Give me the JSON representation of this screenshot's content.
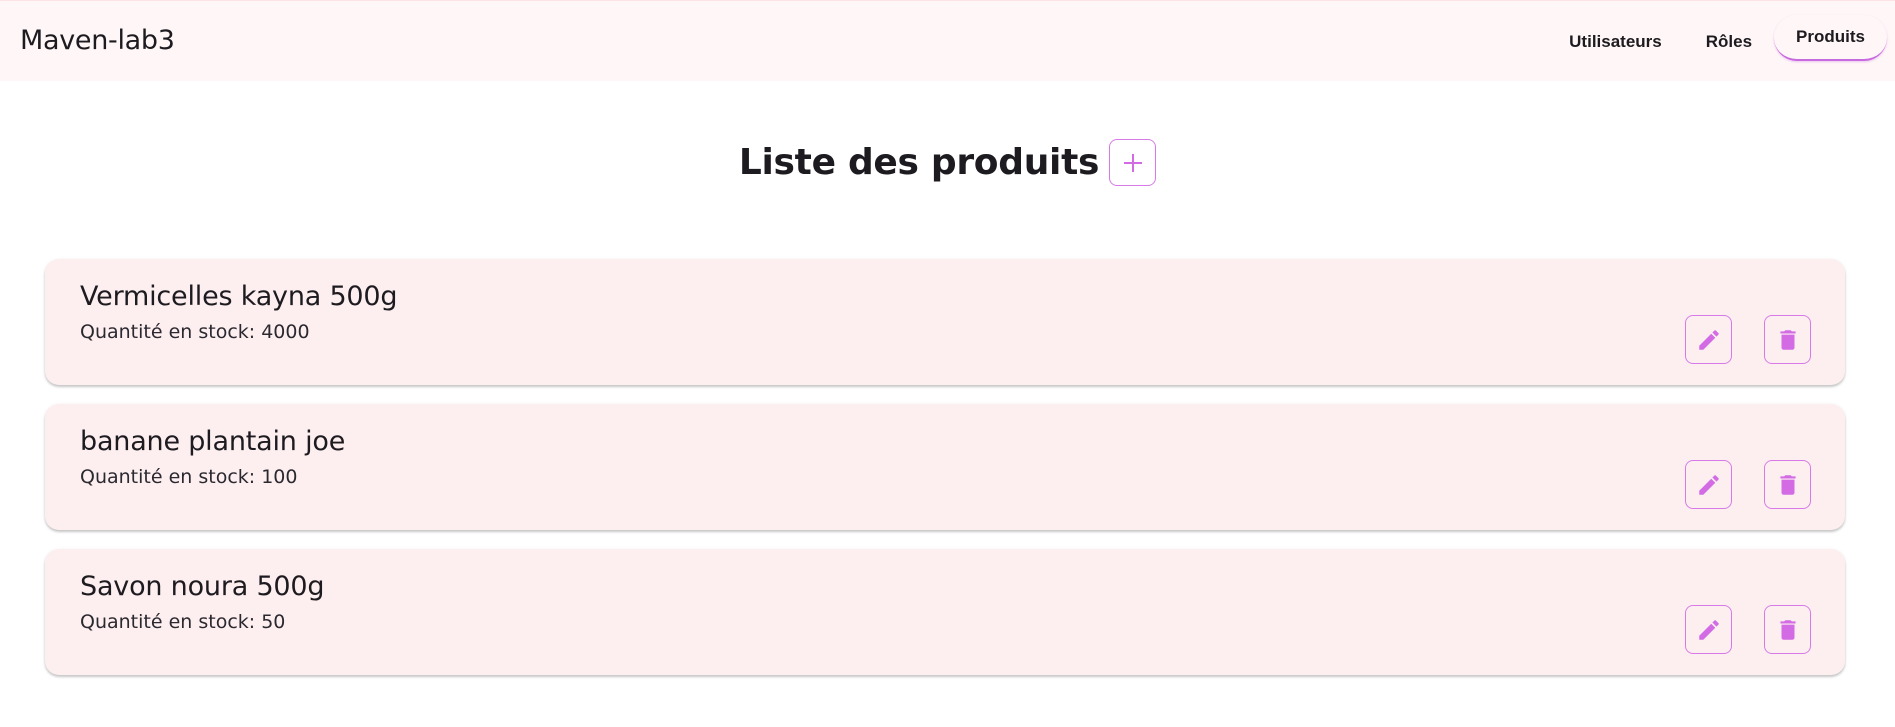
{
  "app": {
    "title": "Maven-lab3"
  },
  "nav": {
    "items": [
      {
        "label": "Utilisateurs",
        "active": false
      },
      {
        "label": "Rôles",
        "active": false
      },
      {
        "label": "Produits",
        "active": true
      }
    ]
  },
  "page": {
    "title": "Liste des produits",
    "add_icon": "plus-icon"
  },
  "products": [
    {
      "name": "Vermicelles kayna 500g",
      "stock_text": "Quantité en stock: 4000",
      "edit_icon": "pencil-icon",
      "delete_icon": "trash-icon"
    },
    {
      "name": "banane plantain joe",
      "stock_text": "Quantité en stock: 100",
      "edit_icon": "pencil-icon",
      "delete_icon": "trash-icon"
    },
    {
      "name": "Savon noura 500g",
      "stock_text": "Quantité en stock: 50",
      "edit_icon": "pencil-icon",
      "delete_icon": "trash-icon"
    }
  ],
  "colors": {
    "accent": "#d77ae8",
    "icon": "#d26be4",
    "card_bg": "#fdeff0",
    "topbar_bg": "#fff7f7"
  }
}
